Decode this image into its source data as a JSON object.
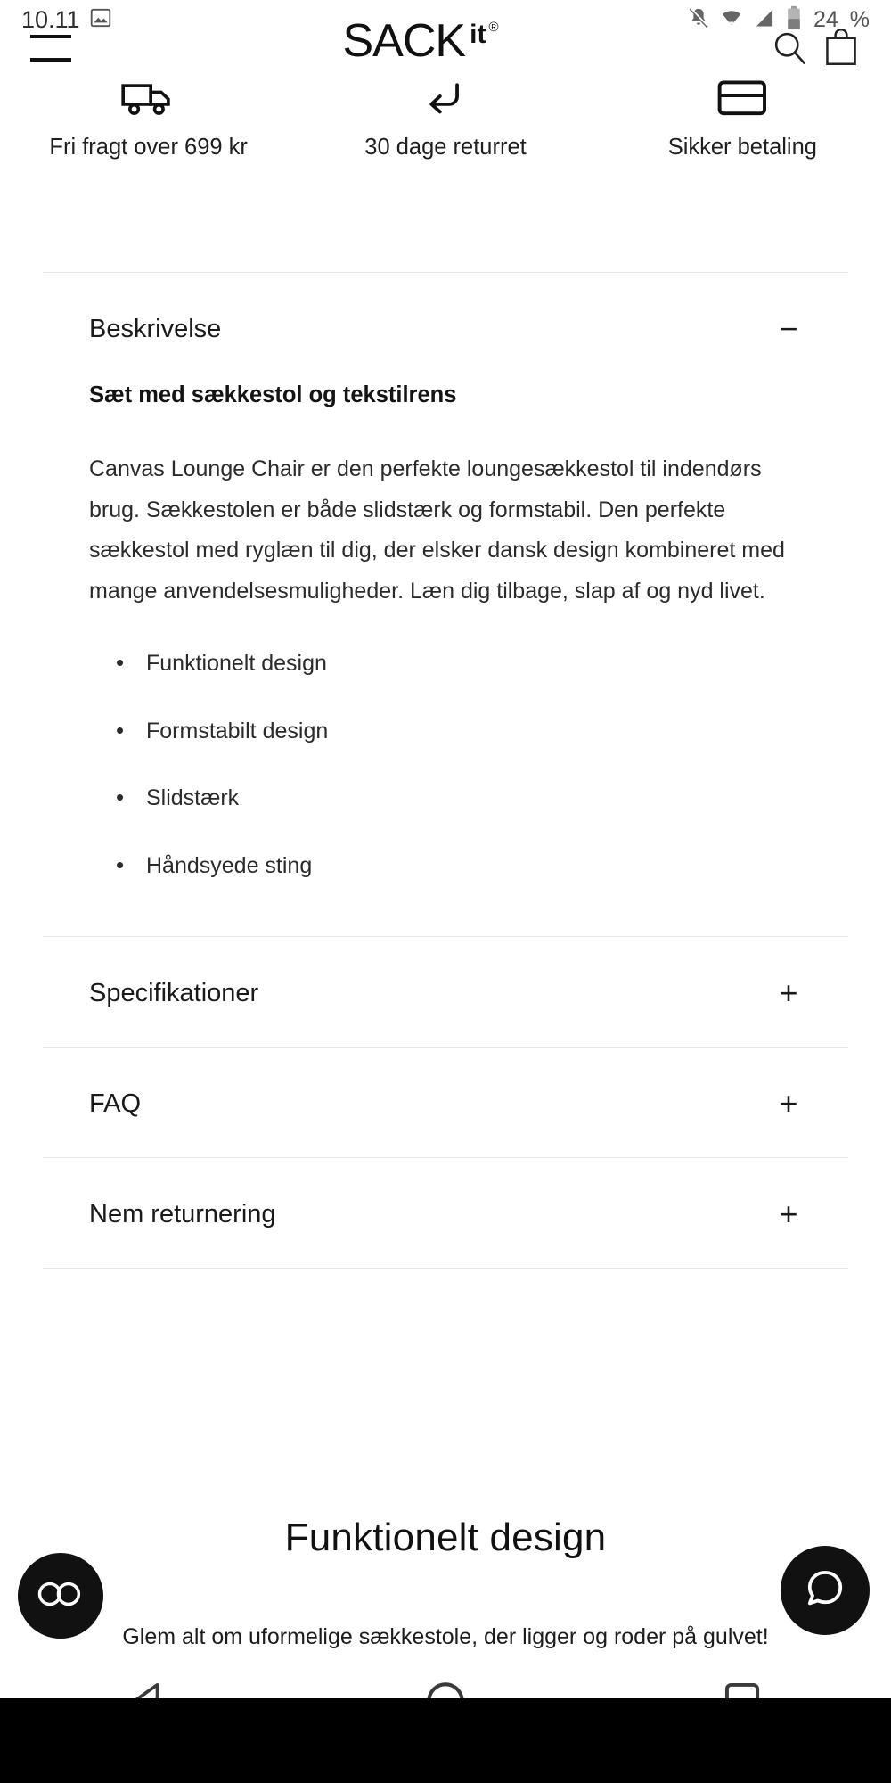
{
  "statusbar": {
    "time": "10.11",
    "battery_percent": "24",
    "icons": [
      "photo-icon",
      "notifications-off-icon",
      "wifi-icon",
      "cell-signal-icon",
      "battery-icon"
    ]
  },
  "header": {
    "menu_label": "menu",
    "logo_main": "SACK",
    "logo_suffix": "it",
    "logo_registered": "®",
    "search_label": "search",
    "cart_label": "cart"
  },
  "usps": [
    {
      "icon": "delivery-truck-icon",
      "label": "Fri fragt over 699 kr"
    },
    {
      "icon": "return-arrow-icon",
      "label": "30 dage returret"
    },
    {
      "icon": "credit-card-icon",
      "label": "Sikker betaling"
    }
  ],
  "accordions": [
    {
      "title": "Beskrivelse",
      "sign": "−",
      "expanded": true,
      "subtitle": "Sæt med sækkestol og tekstilrens",
      "paragraph": "Canvas Lounge Chair er den perfekte loungesækkestol til indendørs brug. Sækkestolen er både slidstærk og formstabil. Den perfekte sækkestol med ryglæn til dig, der elsker dansk design kombineret med mange anvendelsesmuligheder. Læn dig tilbage, slap af og nyd livet.",
      "bullets": [
        "Funktionelt design",
        "Formstabilt design",
        "Slidstærk",
        "Håndsyede sting"
      ]
    },
    {
      "title": "Specifikationer",
      "sign": "+",
      "expanded": false
    },
    {
      "title": "FAQ",
      "sign": "+",
      "expanded": false
    },
    {
      "title": "Nem returnering",
      "sign": "+",
      "expanded": false
    }
  ],
  "feature": {
    "title": "Funktionelt design",
    "subtitle": "Glem alt om uformelige sækkestole, der ligger og roder på gulvet!"
  },
  "floating": {
    "cookie_label": "cookie-settings",
    "chat_label": "chat"
  },
  "navbar": {
    "back_label": "back",
    "home_label": "home",
    "recents_label": "recents"
  },
  "colors": {
    "accent": "#111111",
    "text": "#1a1a1a",
    "rule": "#e4e4e4",
    "navbar": "#000000"
  }
}
